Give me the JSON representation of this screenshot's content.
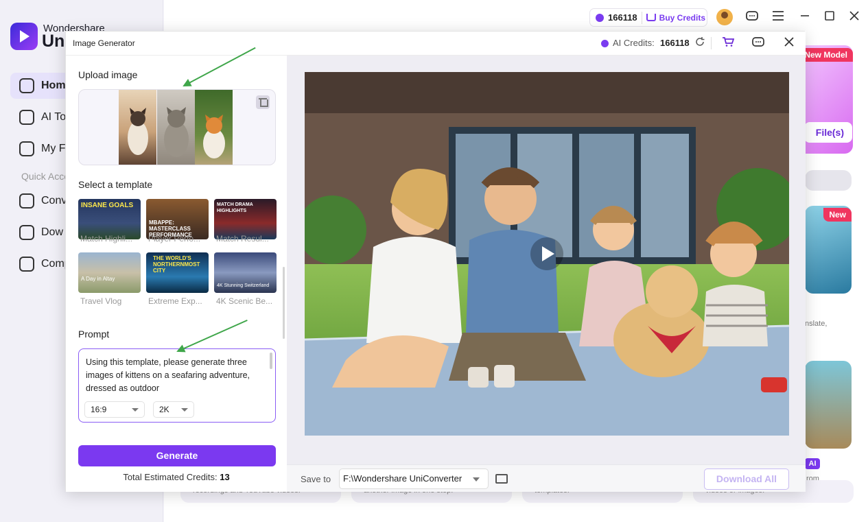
{
  "app": {
    "brand_top": "Wondershare",
    "brand_bottom": "Uni",
    "sidebar": {
      "items": [
        {
          "label": "Hom",
          "icon": "home-icon"
        },
        {
          "label": "AI To",
          "icon": "ai-toolbox-icon"
        },
        {
          "label": "My F",
          "icon": "my-files-icon"
        },
        {
          "label": "Conv",
          "icon": "converter-icon"
        },
        {
          "label": "Dow",
          "icon": "downloader-icon"
        },
        {
          "label": "Comp",
          "icon": "compressor-icon"
        }
      ],
      "quick_access": "Quick Acce"
    },
    "topbar": {
      "credits": "166118",
      "buy_credits": "Buy Credits",
      "icons": [
        "avatar-icon",
        "chat-icon",
        "menu-icon",
        "minimize-icon",
        "maximize-icon",
        "close-icon"
      ]
    },
    "cards": {
      "new_model": "New Model",
      "files_btn": "File(s)",
      "new_badge": "New",
      "translate_fragment": "nslate,",
      "ai_badge": "AI",
      "rom_fragment": "rom",
      "captions": [
        "recordings and YouTube videos.",
        "another image in one step.",
        "templates.",
        "videos or images."
      ]
    }
  },
  "dialog": {
    "title": "Image Generator",
    "ai_credits_label": "AI Credits:",
    "ai_credits_value": "166118",
    "upload_title": "Upload image",
    "template_title": "Select a template",
    "templates": [
      {
        "label": "Match Highli...",
        "caption": "INSANE GOALS",
        "bg": "#1b2a4a"
      },
      {
        "label": "Player Perfo...",
        "caption": "MBAPPE: MASTERCLASS PERFORMANCE",
        "bg": "#5a3a2a"
      },
      {
        "label": "Match Resul...",
        "caption": "MATCH DRAMA HIGHLIGHTS",
        "bg": "#3a1a22"
      },
      {
        "label": "Travel Vlog",
        "caption": "A Day in Altay",
        "bg": "#8aa0b8"
      },
      {
        "label": "Extreme Exp...",
        "caption": "THE WORLD'S NORTHERNMOST CITY",
        "bg": "#1f5a86"
      },
      {
        "label": "4K Scenic Be...",
        "caption": "4K Stunning Switzerland",
        "bg": "#3a4d72"
      }
    ],
    "prompt_title": "Prompt",
    "prompt_text": "Using this template, please generate three images of kittens on a seafaring adventure, dressed as outdoor",
    "aspect_ratio": "16:9",
    "resolution": "2K",
    "generate_label": "Generate",
    "credits_prefix": "Total Estimated Credits:",
    "credits_value": "13",
    "save_to_label": "Save to",
    "save_to_path": "F:\\Wondershare UniConverter",
    "download_all_label": "Download All"
  }
}
